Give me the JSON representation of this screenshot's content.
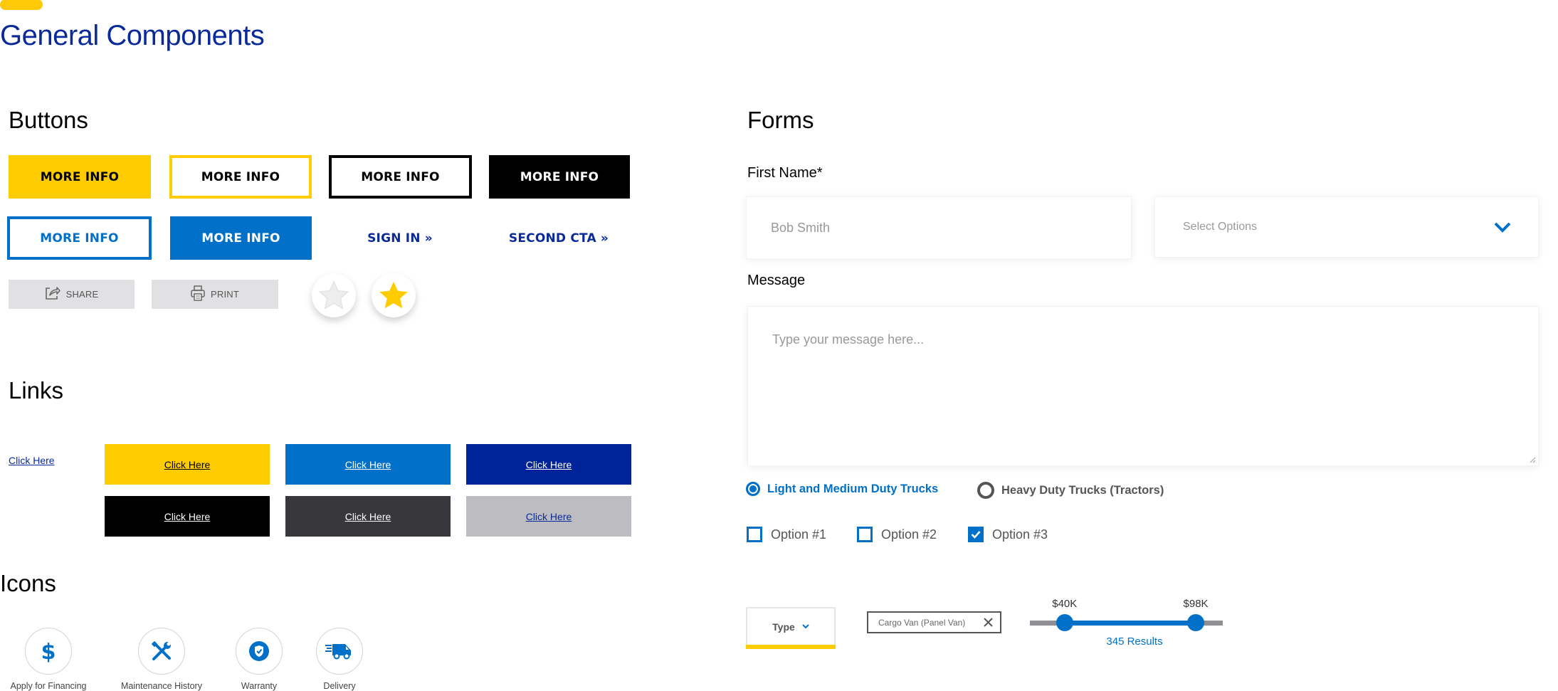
{
  "page": {
    "title": "General Components",
    "accent_color": "#FFCC00",
    "brand_blue": "#0070C9",
    "navy": "#0A2A99"
  },
  "buttons": {
    "heading": "Buttons",
    "more_info_label": "MORE INFO",
    "sign_in_label": "SIGN IN",
    "second_cta_label": "SECOND CTA",
    "cta_arrow": "»",
    "share_label": "SHARE",
    "print_label": "PRINT",
    "favorite_unselected_icon": "star-outline-icon",
    "favorite_selected_icon": "star-filled-icon"
  },
  "links": {
    "heading": "Links",
    "plain_link": "Click Here",
    "styled_links": [
      {
        "label": "Click Here",
        "bg": "#FFCC00",
        "color": "#000000"
      },
      {
        "label": "Click Here",
        "bg": "#0070C9",
        "color": "#ffffff"
      },
      {
        "label": "Click Here",
        "bg": "#002399",
        "color": "#ffffff"
      },
      {
        "label": "Click Here",
        "bg": "#000000",
        "color": "#ffffff"
      },
      {
        "label": "Click Here",
        "bg": "#38383C",
        "color": "#ffffff"
      },
      {
        "label": "Click Here",
        "bg": "#BDBDC1",
        "color": "#0A2A99"
      }
    ]
  },
  "icons": {
    "heading": "Icons",
    "items": [
      {
        "label": "Apply for Financing",
        "icon": "dollar-icon"
      },
      {
        "label": "Maintenance History",
        "icon": "tools-icon"
      },
      {
        "label": "Warranty",
        "icon": "shield-check-icon"
      },
      {
        "label": "Delivery",
        "icon": "delivery-truck-icon"
      }
    ]
  },
  "forms": {
    "heading": "Forms",
    "first_name_label": "First Name*",
    "first_name_placeholder": "Bob Smith",
    "select_placeholder": "Select Options",
    "message_label": "Message",
    "message_placeholder": "Type your message here...",
    "radios": [
      {
        "label": "Light and Medium Duty Trucks",
        "selected": true
      },
      {
        "label": "Heavy Duty Trucks (Tractors)",
        "selected": false
      }
    ],
    "checkboxes": [
      {
        "label": "Option #1",
        "checked": false
      },
      {
        "label": "Option #2",
        "checked": false
      },
      {
        "label": "Option #3",
        "checked": true
      }
    ],
    "type_filter_label": "Type",
    "chip_label": "Cargo Van (Panel Van)",
    "price_slider": {
      "min_label": "$40K",
      "max_label": "$98K",
      "low_fraction": 0.18,
      "high_fraction": 0.86
    },
    "results_label": "345 Results"
  }
}
